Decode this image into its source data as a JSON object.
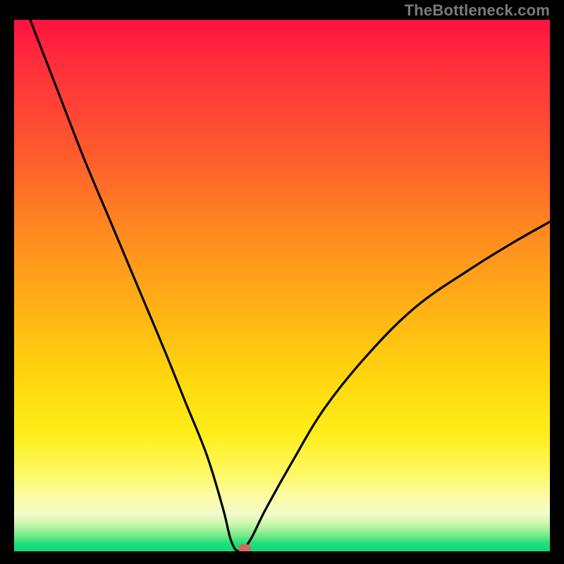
{
  "watermark": "TheBottleneck.com",
  "colors": {
    "frame_bg": "#000000",
    "curve": "#000000",
    "marker": "#d46a5e",
    "gradient_top": "#ff123f",
    "gradient_bottom": "#0fd979"
  },
  "chart_data": {
    "type": "line",
    "title": "",
    "xlabel": "",
    "ylabel": "",
    "xlim": [
      0,
      100
    ],
    "ylim": [
      0,
      100
    ],
    "grid": false,
    "legend": false,
    "note": "V-shaped bottleneck curve: y ≈ |x − 42| scaled; minimum near x≈42, y≈0. Left branch starts near top-left (x≈3, y≈100); right branch rises to about y≈62 at x=100.",
    "series": [
      {
        "name": "bottleneck-curve",
        "x": [
          3,
          8,
          13,
          18,
          23,
          28,
          32,
          36,
          39,
          40.5,
          42,
          44,
          47,
          52,
          58,
          66,
          75,
          85,
          93,
          100
        ],
        "y": [
          100,
          87,
          74,
          62,
          50,
          38,
          28,
          18,
          8,
          2,
          0,
          2,
          8,
          17,
          27,
          37,
          46,
          53,
          58,
          62
        ]
      }
    ],
    "marker": {
      "x": 43,
      "y": 0.5,
      "shape": "pill",
      "color": "#d46a5e"
    }
  }
}
